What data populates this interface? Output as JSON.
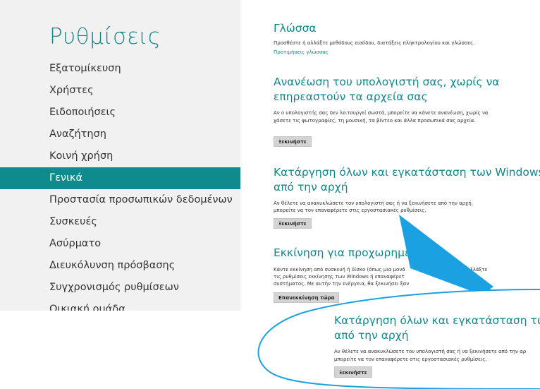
{
  "sidebar": {
    "title": "Ρυθμίσεις",
    "items": [
      {
        "label": "Εξατομίκευση"
      },
      {
        "label": "Χρήστες"
      },
      {
        "label": "Ειδοποιήσεις"
      },
      {
        "label": "Αναζήτηση"
      },
      {
        "label": "Κοινή χρήση"
      },
      {
        "label": "Γενικά",
        "active": true
      },
      {
        "label": "Προστασία προσωπικών δεδομένων"
      },
      {
        "label": "Συσκευές"
      },
      {
        "label": "Ασύρματο"
      },
      {
        "label": "Διευκόλυνση πρόσβασης"
      },
      {
        "label": "Συγχρονισμός ρυθμίσεων"
      },
      {
        "label": "Οικιακή ομάδα"
      }
    ]
  },
  "content": {
    "language": {
      "title": "Γλώσσα",
      "text": "Προσθέστε ή αλλάξτε μεθόδους εισόδου, διατάξεις πληκτρολογίου και γλώσσες.",
      "link": "Προτιμήσεις γλώσσας"
    },
    "refresh": {
      "title_line1": "Ανανέωση του υπολογιστή σας, χωρίς να",
      "title_line2": "επηρεαστούν τα αρχεία σας",
      "text": "Αν ο υπολογιστής σας δεν λειτουργεί σωστά, μπορείτε να κάνετε ανανέωση, χωρίς να χάσετε τις φωτογραφίες, τη μουσική, τα βίντεο και άλλα προσωπικά σας αρχεία.",
      "button": "Ξεκινήστε"
    },
    "reset": {
      "title_line1": "Κατάργηση όλων και εγκατάσταση των Windows",
      "title_line2": "από την αρχή",
      "text_line1": "Αν θέλετε να ανακυκλώσετε τον υπολογιστή σας ή να ξεκινήσετε από την αρχή,",
      "text_line2": "μπορείτε να τον επαναφέρετε στις εργοστασιακές ρυθμίσεις.",
      "button": "Ξεκινήστε"
    },
    "advanced": {
      "title": "Εκκίνηση για προχωρημένου",
      "text_line1": "Κάντε εκκίνηση από συσκευή ή δίσκο (όπως μια μονά",
      "text_line1b": "αλλάξτε",
      "text_line2": "τις ρυθμίσεις εκκίνησης των Windows ή επαναφέρετ",
      "text_line2b": "ιδο",
      "text_line3": "συστήματος. Με αυτήν την ενέργεια, θα ξεκινήσει ξαν",
      "button": "Επανεκκίνηση τώρα"
    }
  },
  "zoom": {
    "title_line1": "Κατάργηση όλων και εγκατάσταση των Win",
    "title_line2": "από την αρχή",
    "text_line1": "Αν θέλετε να ανακυκλώσετε τον υπολογιστή σας ή να ξεκινήσετε από την αρ",
    "text_line2": "μπορείτε να τον επαναφέρετε στις εργοστασιακές ρυθμίσεις.",
    "button": "Ξεκινήστε"
  },
  "colors": {
    "accent": "#0f8a8d",
    "callout": "#1ba1e2"
  }
}
